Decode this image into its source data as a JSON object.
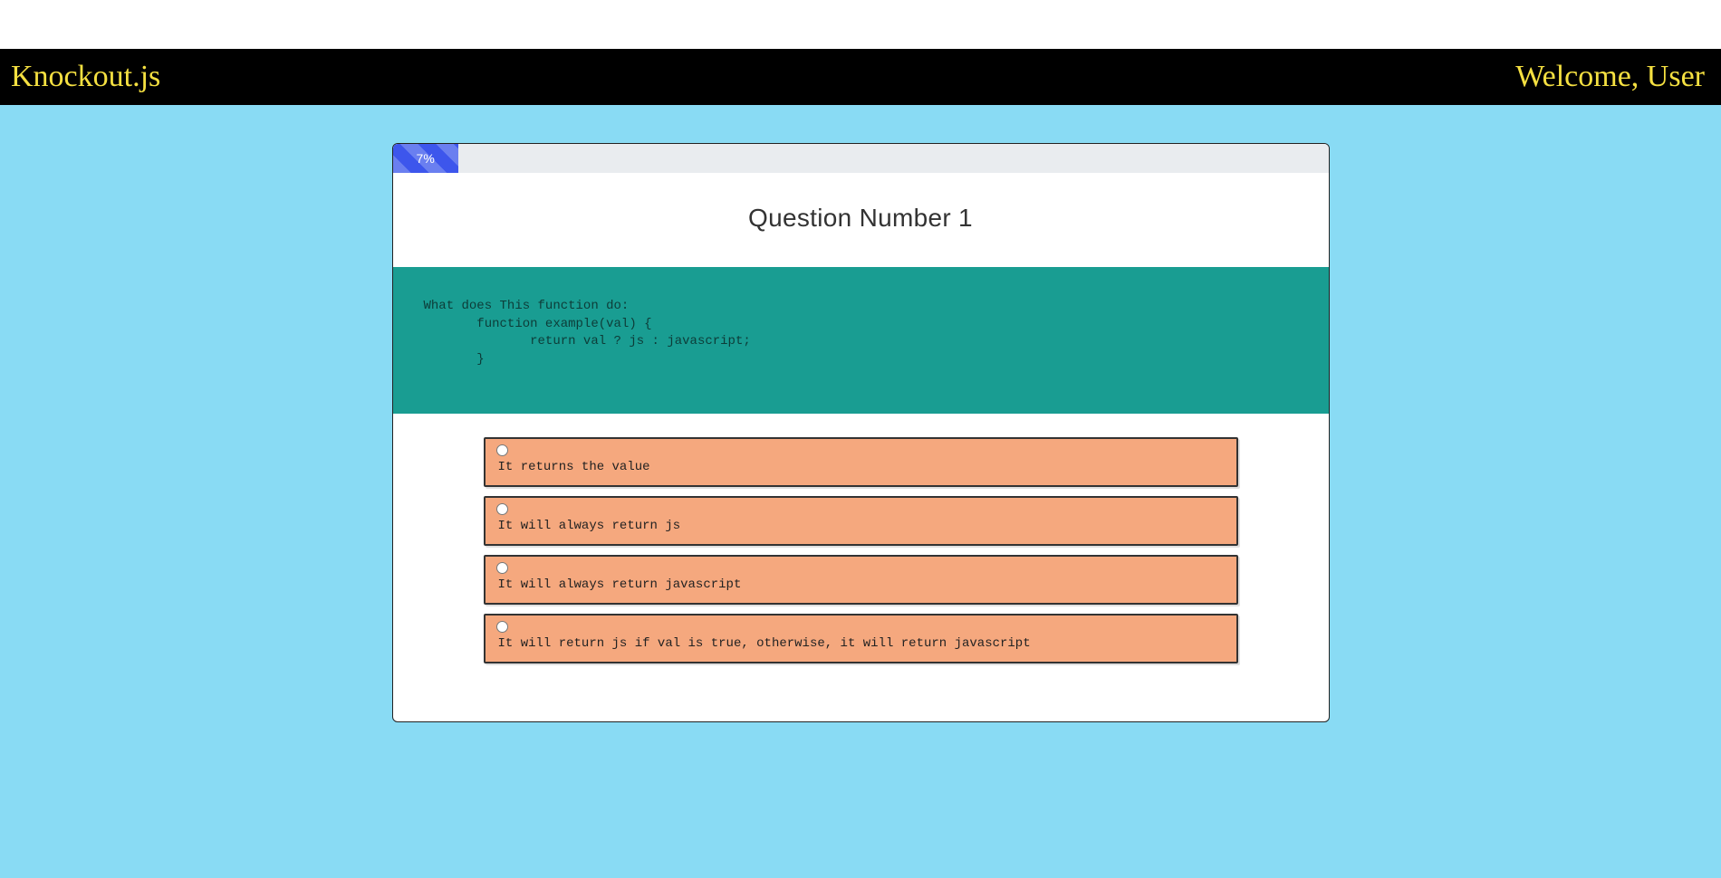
{
  "header": {
    "brand": "Knockout.js",
    "welcome": "Welcome, User"
  },
  "progress": {
    "percent": 7,
    "label": "7%"
  },
  "question": {
    "title": "Question Number 1",
    "code": "What does This function do:\n       function example(val) {\n              return val ? js : javascript;\n       }"
  },
  "answers": [
    {
      "text": "It returns the value"
    },
    {
      "text": "It will always return js"
    },
    {
      "text": "It will always return javascript"
    },
    {
      "text": "It will return js if val is true, otherwise, it will return javascript"
    }
  ]
}
